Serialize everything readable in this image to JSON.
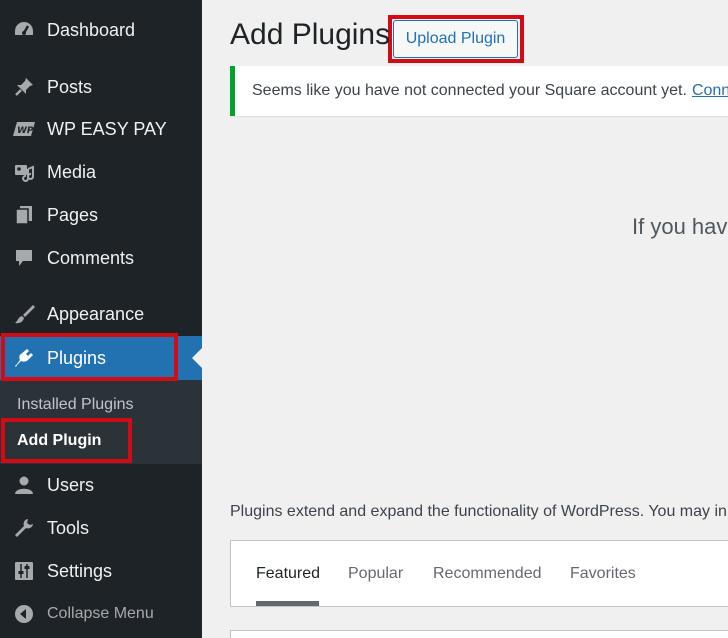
{
  "sidebar": {
    "items": [
      {
        "label": "Dashboard",
        "icon": "dashboard-icon"
      },
      {
        "label": "Posts",
        "icon": "pin-icon"
      },
      {
        "label": "WP EASY PAY",
        "icon": "wp-easy-pay-icon"
      },
      {
        "label": "Media",
        "icon": "media-icon"
      },
      {
        "label": "Pages",
        "icon": "pages-icon"
      },
      {
        "label": "Comments",
        "icon": "comment-icon"
      },
      {
        "label": "Appearance",
        "icon": "paintbrush-icon"
      },
      {
        "label": "Plugins",
        "icon": "plug-icon"
      },
      {
        "label": "Users",
        "icon": "user-icon"
      },
      {
        "label": "Tools",
        "icon": "wrench-icon"
      },
      {
        "label": "Settings",
        "icon": "sliders-icon"
      }
    ],
    "plugins_submenu": [
      {
        "label": "Installed Plugins"
      },
      {
        "label": "Add Plugin"
      }
    ],
    "collapse_label": "Collapse Menu",
    "active_color": "#2271b1",
    "bg_color": "#1d2327",
    "highlight_color": "#d20c17"
  },
  "main": {
    "title": "Add Plugins",
    "upload_button": "Upload Plugin",
    "notice": {
      "text": "Seems like you have not connected your Square account yet.",
      "link": "Conn"
    },
    "upload_hint": "If you hav",
    "description": "Plugins extend and expand the functionality of WordPress. You may in",
    "tabs": [
      {
        "label": "Featured"
      },
      {
        "label": "Popular"
      },
      {
        "label": "Recommended"
      },
      {
        "label": "Favorites"
      }
    ],
    "selected_tab": "Featured"
  }
}
